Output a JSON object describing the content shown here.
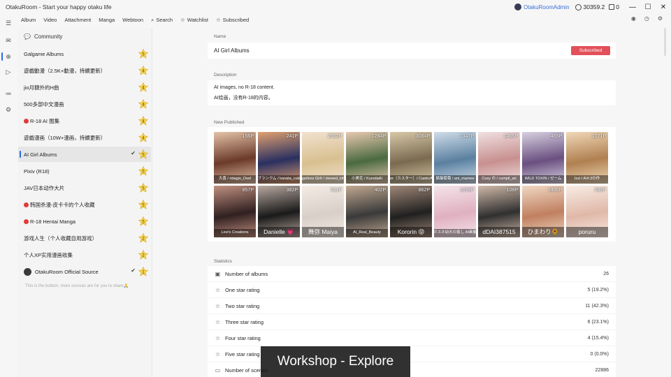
{
  "window": {
    "title": "OtakuRoom - Start your happy otaku life",
    "user_name": "OtakuRoomAdmin",
    "points": "30359.2",
    "messages": "0"
  },
  "topnav": [
    {
      "label": "Album",
      "icon": ""
    },
    {
      "label": "Video",
      "icon": ""
    },
    {
      "label": "Attachment",
      "icon": ""
    },
    {
      "label": "Manga",
      "icon": ""
    },
    {
      "label": "Webtoon",
      "icon": ""
    },
    {
      "label": "Search",
      "icon": "search-icon"
    },
    {
      "label": "Watchlist",
      "icon": "star-icon"
    },
    {
      "label": "Subscribed",
      "icon": "star-icon"
    }
  ],
  "sidebar": {
    "header": "Community",
    "items": [
      {
        "label": "Galgame Albums",
        "badge": "5",
        "checked": false,
        "red": false
      },
      {
        "label": "遊戲動漫（2.5K+動漫，持續更新）",
        "badge": "4",
        "checked": false,
        "red": false
      },
      {
        "label": "jio月額外的H曲",
        "badge": "4",
        "checked": false,
        "red": false
      },
      {
        "label": "500多部中文漫画",
        "badge": "4",
        "checked": false,
        "red": false
      },
      {
        "label": "R-18 AI 图集",
        "badge": "4",
        "checked": false,
        "red": true
      },
      {
        "label": "遊戲漫画（10W+漫画，持續更新）",
        "badge": "4",
        "checked": false,
        "red": false
      },
      {
        "label": "AI Girl Albums",
        "badge": "5",
        "checked": true,
        "red": false,
        "selected": true
      },
      {
        "label": "Pixiv (R18)",
        "badge": "5",
        "checked": false,
        "red": false
      },
      {
        "label": "JAV日本动作大片",
        "badge": "5",
        "checked": false,
        "red": false
      },
      {
        "label": "韩国杀漫-皮卡卡的个人收藏",
        "badge": "5",
        "checked": false,
        "red": true
      },
      {
        "label": "R-18 Hentai Manga",
        "badge": "5",
        "checked": false,
        "red": true
      },
      {
        "label": "游戏人生（个人收藏自用游戏）",
        "badge": "2",
        "checked": false,
        "red": false
      },
      {
        "label": "个人XP实用漫画收集",
        "badge": "2",
        "checked": false,
        "red": false
      },
      {
        "label": "OtakuRoom Official Source",
        "badge": "1",
        "checked": true,
        "red": false,
        "avatar": true
      }
    ],
    "bottom_note": "This is the bottom, more sources are for you to share🙏"
  },
  "main": {
    "name_label": "Name",
    "name_value": "AI Girl Albums",
    "subscribed_label": "Subscribed",
    "description_label": "Description",
    "description_line1": "AI images, no R-18 content.",
    "description_line2": "AI绘画，没有R-18的内容。",
    "new_published_label": "New Published",
    "thumbs": [
      {
        "count": "156P",
        "caption": "大喜 / ridagio_Dwd",
        "c1": "#6b3a2a",
        "c2": "#e3c3a8",
        "big": false
      },
      {
        "count": "241P",
        "caption": "ブランクム / kanata_cuki",
        "c1": "#2a3060",
        "c2": "#e0a070",
        "big": false
      },
      {
        "count": "2552P",
        "caption": "Sugarless Girlt / stewed_kitten",
        "c1": "#d8c090",
        "c2": "#f2e2d0",
        "big": false
      },
      {
        "count": "1284P",
        "caption": "小美花 / KurodaAI",
        "c1": "#4a6a40",
        "c2": "#e8c8b0",
        "big": false
      },
      {
        "count": "3084P",
        "caption": "Castor（カスター）/ CastorAiLab",
        "c1": "#7a6a50",
        "c2": "#d8c8a8",
        "big": false
      },
      {
        "count": "1347P",
        "caption": "猫猫菊菊 / ani_mamee",
        "c1": "#5a80a0",
        "c2": "#d0dde8",
        "big": false
      },
      {
        "count": "1466P",
        "caption": "Cuxy の / cumpil_ari",
        "c1": "#c89090",
        "c2": "#f0e0e0",
        "big": false
      },
      {
        "count": "465P",
        "caption": "WILD TOXIN / ゼーム",
        "c1": "#6a5080",
        "c2": "#d8d0e0",
        "big": false
      },
      {
        "count": "1071P",
        "caption": "Izzi / AI4:3の作",
        "c1": "#b08050",
        "c2": "#f0d8b8",
        "big": false
      },
      {
        "count": "857P",
        "caption": "Levi's Creations",
        "c1": "#302020",
        "c2": "#c09080",
        "big": false
      },
      {
        "count": "382P",
        "caption": "Danielle 💗",
        "c1": "#1a1a1a",
        "c2": "#b8a8a0",
        "big": true
      },
      {
        "count": "511P",
        "caption": "舞弥 Maiya",
        "c1": "#d8d0c8",
        "c2": "#f4ece4",
        "big": true
      },
      {
        "count": "402P",
        "caption": "AI_Real_Beauty",
        "c1": "#3a3a3a",
        "c2": "#c0a890",
        "big": false
      },
      {
        "count": "862P",
        "caption": "Kororin 😝",
        "c1": "#202020",
        "c2": "#a08878",
        "big": true
      },
      {
        "count": "1059P",
        "caption": "ホスネ幼天の蒸し AI画像",
        "c1": "#e0b0c0",
        "c2": "#f4e4ea",
        "big": false
      },
      {
        "count": "108P",
        "caption": "dDAI387515",
        "c1": "#303030",
        "c2": "#d0b8a8",
        "big": true
      },
      {
        "count": "1406P",
        "caption": "ひまわり🌻",
        "c1": "#c08060",
        "c2": "#f0d8c4",
        "big": true
      },
      {
        "count": "538P",
        "caption": "poruru",
        "c1": "#e0b8a8",
        "c2": "#f8ece4",
        "big": true
      }
    ],
    "statistics_label": "Statistics",
    "stats": [
      {
        "label": "Number of albums",
        "value": "26",
        "icon": "album-icon"
      },
      {
        "label": "One star rating",
        "value": "5 (19.2%)",
        "icon": "star-1-icon"
      },
      {
        "label": "Two star rating",
        "value": "11 (42.3%)",
        "icon": "star-2-icon"
      },
      {
        "label": "Three star rating",
        "value": "6 (23.1%)",
        "icon": "star-3-icon"
      },
      {
        "label": "Four star rating",
        "value": "4 (15.4%)",
        "icon": "star-4-icon"
      },
      {
        "label": "Five star rating",
        "value": "0 (0.0%)",
        "icon": "star-5-icon"
      },
      {
        "label": "Number of scenes",
        "value": "22886",
        "icon": "image-icon"
      }
    ]
  },
  "overlay": "Workshop - Explore"
}
